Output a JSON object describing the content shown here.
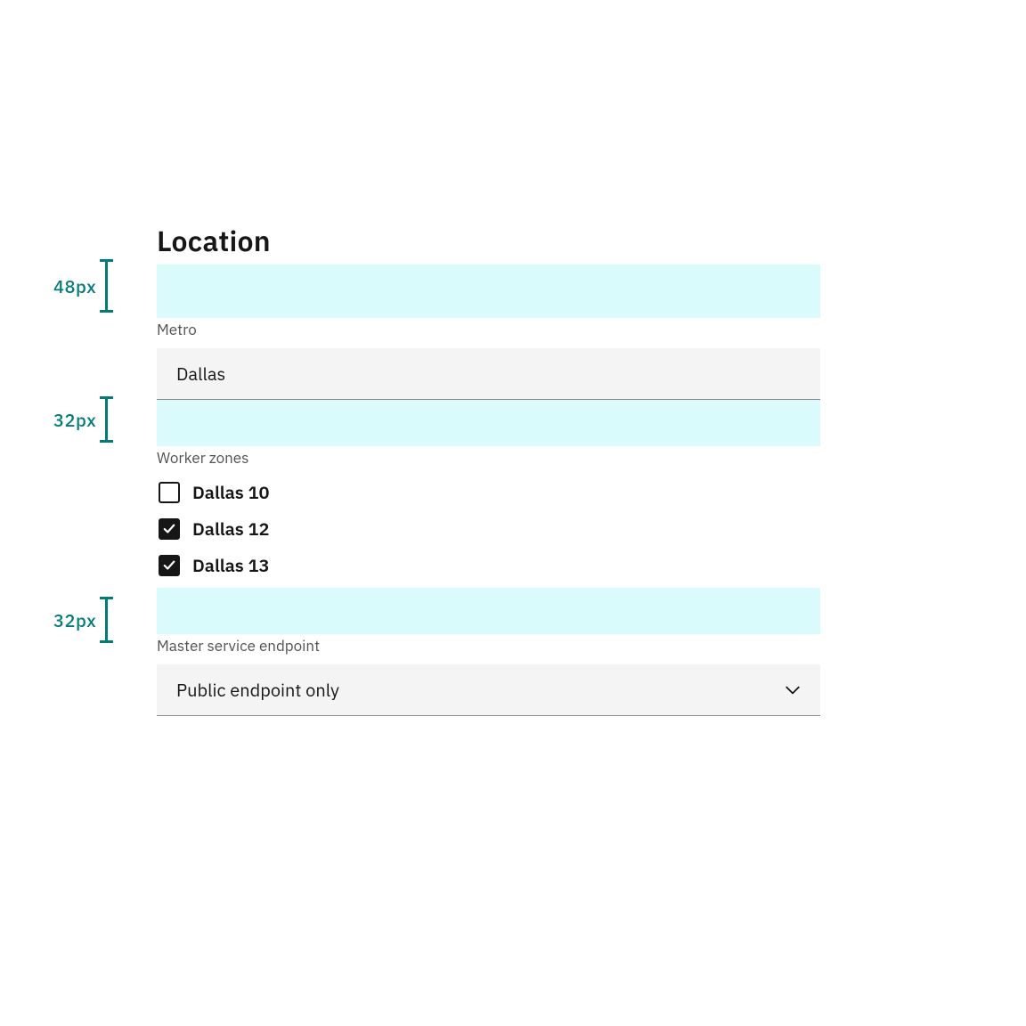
{
  "heading": "Location",
  "labels": {
    "metro": "Metro",
    "worker_zones": "Worker zones",
    "master_endpoint": "Master service endpoint"
  },
  "metro_select": "Dallas",
  "zones": [
    {
      "label": "Dallas 10",
      "checked": false
    },
    {
      "label": "Dallas 12",
      "checked": true
    },
    {
      "label": "Dallas 13",
      "checked": true
    }
  ],
  "endpoint_select": "Public endpoint only",
  "measurements": {
    "a": "48px",
    "b": "32px",
    "c": "32px"
  },
  "colors": {
    "spacer": "#d9fbfb",
    "measure": "#007d79",
    "field_bg": "#f4f4f4"
  }
}
